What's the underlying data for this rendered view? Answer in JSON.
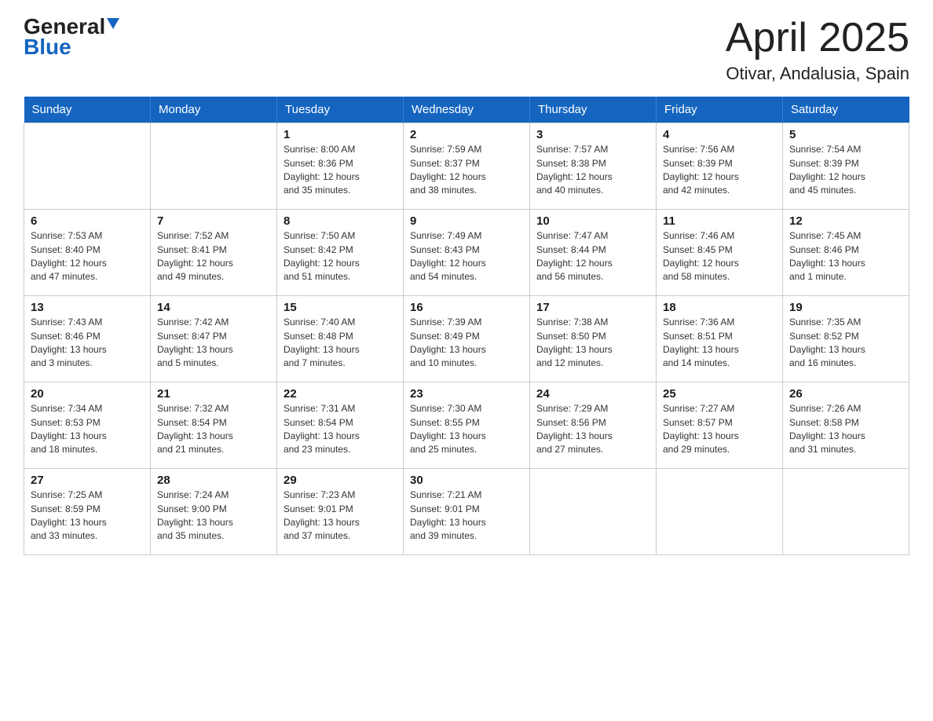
{
  "logo": {
    "general": "General",
    "blue": "Blue"
  },
  "header": {
    "title": "April 2025",
    "subtitle": "Otivar, Andalusia, Spain"
  },
  "weekdays": [
    "Sunday",
    "Monday",
    "Tuesday",
    "Wednesday",
    "Thursday",
    "Friday",
    "Saturday"
  ],
  "weeks": [
    [
      {
        "day": "",
        "info": ""
      },
      {
        "day": "",
        "info": ""
      },
      {
        "day": "1",
        "info": "Sunrise: 8:00 AM\nSunset: 8:36 PM\nDaylight: 12 hours\nand 35 minutes."
      },
      {
        "day": "2",
        "info": "Sunrise: 7:59 AM\nSunset: 8:37 PM\nDaylight: 12 hours\nand 38 minutes."
      },
      {
        "day": "3",
        "info": "Sunrise: 7:57 AM\nSunset: 8:38 PM\nDaylight: 12 hours\nand 40 minutes."
      },
      {
        "day": "4",
        "info": "Sunrise: 7:56 AM\nSunset: 8:39 PM\nDaylight: 12 hours\nand 42 minutes."
      },
      {
        "day": "5",
        "info": "Sunrise: 7:54 AM\nSunset: 8:39 PM\nDaylight: 12 hours\nand 45 minutes."
      }
    ],
    [
      {
        "day": "6",
        "info": "Sunrise: 7:53 AM\nSunset: 8:40 PM\nDaylight: 12 hours\nand 47 minutes."
      },
      {
        "day": "7",
        "info": "Sunrise: 7:52 AM\nSunset: 8:41 PM\nDaylight: 12 hours\nand 49 minutes."
      },
      {
        "day": "8",
        "info": "Sunrise: 7:50 AM\nSunset: 8:42 PM\nDaylight: 12 hours\nand 51 minutes."
      },
      {
        "day": "9",
        "info": "Sunrise: 7:49 AM\nSunset: 8:43 PM\nDaylight: 12 hours\nand 54 minutes."
      },
      {
        "day": "10",
        "info": "Sunrise: 7:47 AM\nSunset: 8:44 PM\nDaylight: 12 hours\nand 56 minutes."
      },
      {
        "day": "11",
        "info": "Sunrise: 7:46 AM\nSunset: 8:45 PM\nDaylight: 12 hours\nand 58 minutes."
      },
      {
        "day": "12",
        "info": "Sunrise: 7:45 AM\nSunset: 8:46 PM\nDaylight: 13 hours\nand 1 minute."
      }
    ],
    [
      {
        "day": "13",
        "info": "Sunrise: 7:43 AM\nSunset: 8:46 PM\nDaylight: 13 hours\nand 3 minutes."
      },
      {
        "day": "14",
        "info": "Sunrise: 7:42 AM\nSunset: 8:47 PM\nDaylight: 13 hours\nand 5 minutes."
      },
      {
        "day": "15",
        "info": "Sunrise: 7:40 AM\nSunset: 8:48 PM\nDaylight: 13 hours\nand 7 minutes."
      },
      {
        "day": "16",
        "info": "Sunrise: 7:39 AM\nSunset: 8:49 PM\nDaylight: 13 hours\nand 10 minutes."
      },
      {
        "day": "17",
        "info": "Sunrise: 7:38 AM\nSunset: 8:50 PM\nDaylight: 13 hours\nand 12 minutes."
      },
      {
        "day": "18",
        "info": "Sunrise: 7:36 AM\nSunset: 8:51 PM\nDaylight: 13 hours\nand 14 minutes."
      },
      {
        "day": "19",
        "info": "Sunrise: 7:35 AM\nSunset: 8:52 PM\nDaylight: 13 hours\nand 16 minutes."
      }
    ],
    [
      {
        "day": "20",
        "info": "Sunrise: 7:34 AM\nSunset: 8:53 PM\nDaylight: 13 hours\nand 18 minutes."
      },
      {
        "day": "21",
        "info": "Sunrise: 7:32 AM\nSunset: 8:54 PM\nDaylight: 13 hours\nand 21 minutes."
      },
      {
        "day": "22",
        "info": "Sunrise: 7:31 AM\nSunset: 8:54 PM\nDaylight: 13 hours\nand 23 minutes."
      },
      {
        "day": "23",
        "info": "Sunrise: 7:30 AM\nSunset: 8:55 PM\nDaylight: 13 hours\nand 25 minutes."
      },
      {
        "day": "24",
        "info": "Sunrise: 7:29 AM\nSunset: 8:56 PM\nDaylight: 13 hours\nand 27 minutes."
      },
      {
        "day": "25",
        "info": "Sunrise: 7:27 AM\nSunset: 8:57 PM\nDaylight: 13 hours\nand 29 minutes."
      },
      {
        "day": "26",
        "info": "Sunrise: 7:26 AM\nSunset: 8:58 PM\nDaylight: 13 hours\nand 31 minutes."
      }
    ],
    [
      {
        "day": "27",
        "info": "Sunrise: 7:25 AM\nSunset: 8:59 PM\nDaylight: 13 hours\nand 33 minutes."
      },
      {
        "day": "28",
        "info": "Sunrise: 7:24 AM\nSunset: 9:00 PM\nDaylight: 13 hours\nand 35 minutes."
      },
      {
        "day": "29",
        "info": "Sunrise: 7:23 AM\nSunset: 9:01 PM\nDaylight: 13 hours\nand 37 minutes."
      },
      {
        "day": "30",
        "info": "Sunrise: 7:21 AM\nSunset: 9:01 PM\nDaylight: 13 hours\nand 39 minutes."
      },
      {
        "day": "",
        "info": ""
      },
      {
        "day": "",
        "info": ""
      },
      {
        "day": "",
        "info": ""
      }
    ]
  ]
}
